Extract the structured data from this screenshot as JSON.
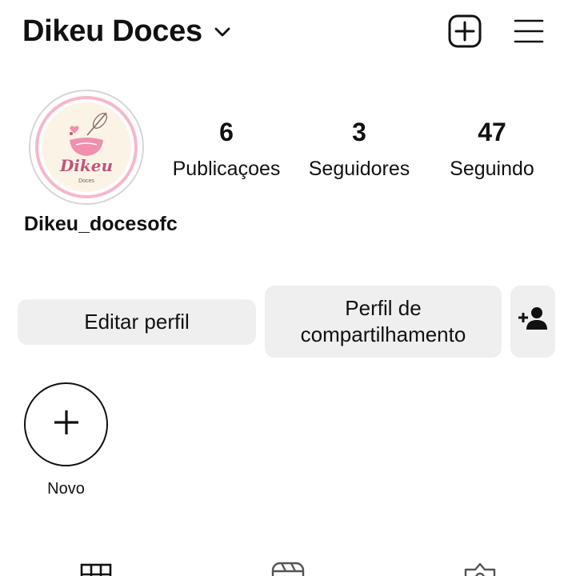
{
  "header": {
    "account_name": "Dikeu Doces"
  },
  "profile": {
    "avatar_text": "Dikeu",
    "avatar_subtext": "Doces",
    "username": "Dikeu_docesofc"
  },
  "stats": [
    {
      "value": "6",
      "label": "Publicaçoes"
    },
    {
      "value": "3",
      "label": "Seguidores"
    },
    {
      "value": "47",
      "label": "Seguindo"
    }
  ],
  "actions": {
    "edit_label": "Editar perfil",
    "share_line1": "Perfil de",
    "share_line2": "compartilhamento"
  },
  "highlights": {
    "new_label": "Novo"
  },
  "icons": {
    "header_new": "add-post-icon",
    "header_menu": "menu-icon",
    "discover": "add-person-icon",
    "tabs": [
      "grid-icon",
      "reels-icon",
      "tagged-icon"
    ]
  },
  "colors": {
    "button_bg": "#efefef",
    "avatar_ring": "#d6d6d6",
    "logo_pink": "#f2a7bd",
    "logo_text": "#c0557b",
    "logo_cream": "#fbf4e6"
  }
}
